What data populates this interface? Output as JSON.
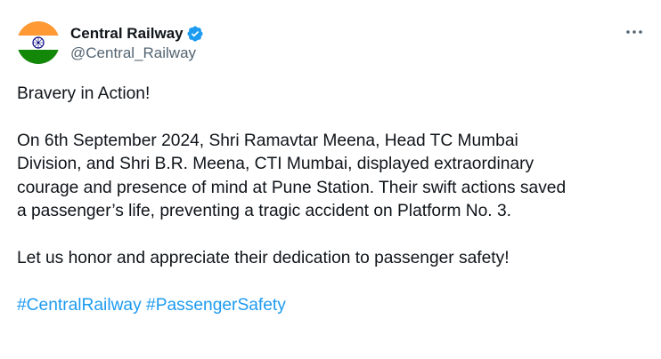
{
  "tweet": {
    "author": {
      "display_name": "Central Railway",
      "handle": "@Central_Railway",
      "verified_icon": "verified-badge-icon",
      "avatar_icon": "indian-flag-avatar"
    },
    "more_icon": "more-options-icon",
    "text": {
      "line1": "Bravery in Action!",
      "paragraph2": {
        "line1": "On 6th September 2024, Shri Ramavtar Meena, Head TC Mumbai",
        "line2": "Division, and Shri B.R. Meena, CTI Mumbai, displayed extraordinary",
        "line3": "courage and presence of mind at Pune Station. Their swift actions saved",
        "line4": "a passenger’s life, preventing a tragic accident on Platform No. 3."
      },
      "paragraph3": "Let us honor and appreciate their dedication to passenger safety!",
      "hashtags": [
        "#CentralRailway",
        "#PassengerSafety"
      ]
    }
  },
  "colors": {
    "text": "#0f1419",
    "secondary": "#536471",
    "link": "#1d9bf0",
    "verified": "#1d9bf0",
    "saffron": "#ff9933",
    "green": "#138808",
    "chakra": "#000080"
  }
}
